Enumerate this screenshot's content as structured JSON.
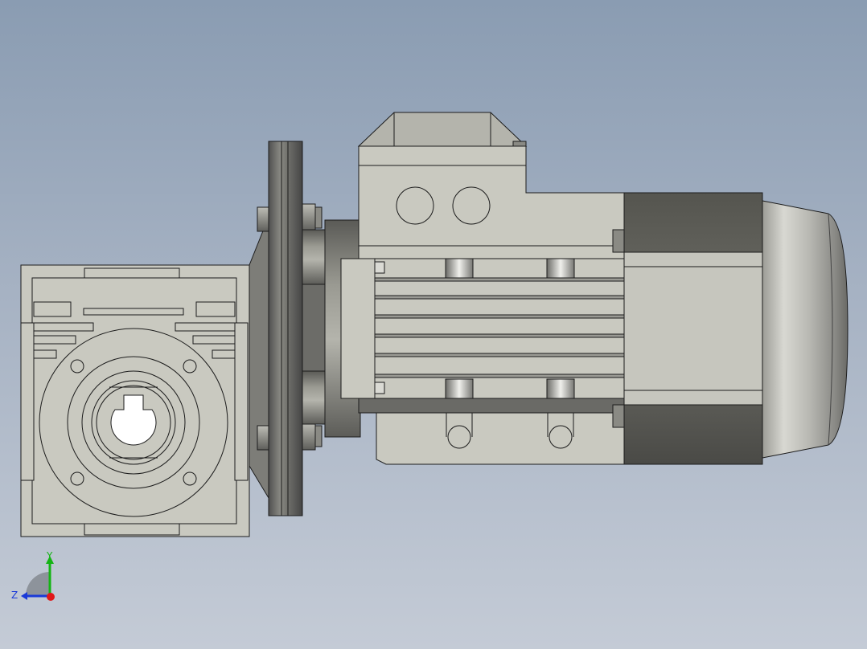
{
  "viewport": {
    "background_top": "#8a9cb2",
    "background_bottom": "#c4cbd6"
  },
  "model": {
    "parts": [
      "worm-gearbox",
      "input-flange",
      "motor-adapter",
      "terminal-box",
      "motor-body",
      "end-cover",
      "fan-cover"
    ],
    "body_color": "#c9c9c0",
    "edge_color": "#1c1c1c"
  },
  "triad": {
    "x_color": "#e01818",
    "y_color": "#14b414",
    "z_color": "#1a3ad8",
    "y_label": "Y",
    "z_label": "Z"
  }
}
